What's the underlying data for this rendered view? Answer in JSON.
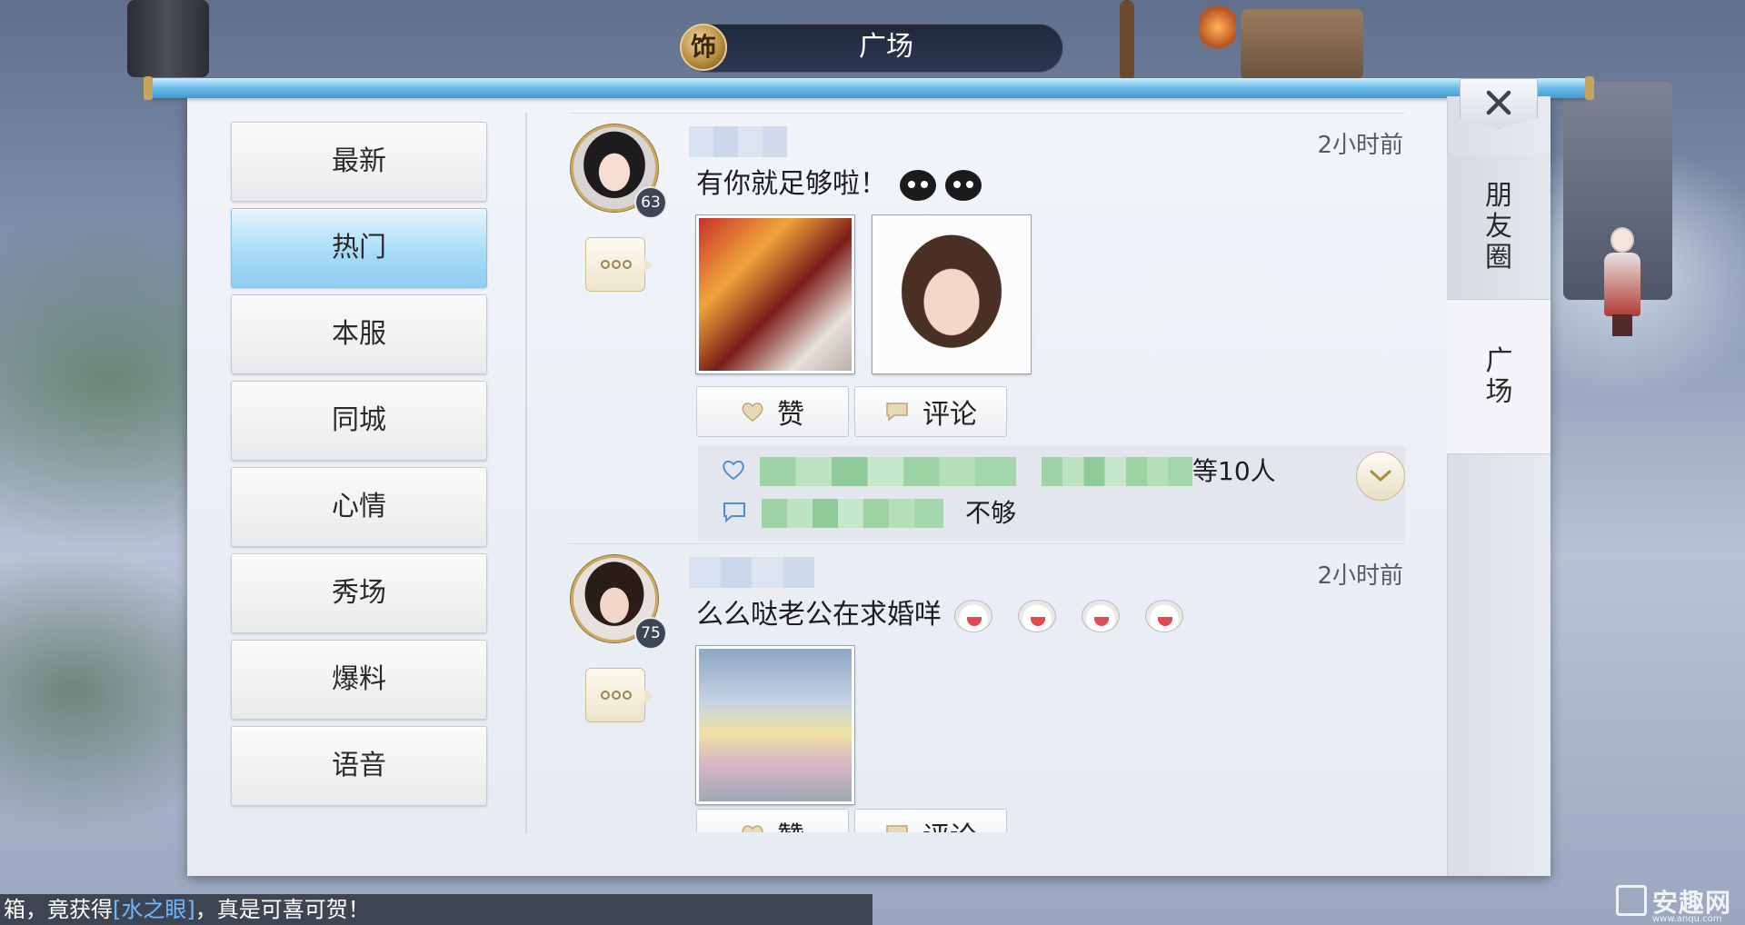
{
  "title_bar": {
    "emblem_char": "饰",
    "title": "广场"
  },
  "categories": [
    {
      "label": "最新",
      "active": false
    },
    {
      "label": "热门",
      "active": true
    },
    {
      "label": "本服",
      "active": false
    },
    {
      "label": "同城",
      "active": false
    },
    {
      "label": "心情",
      "active": false
    },
    {
      "label": "秀场",
      "active": false
    },
    {
      "label": "爆料",
      "active": false
    },
    {
      "label": "语音",
      "active": false
    }
  ],
  "side_tabs": {
    "friends": [
      "朋",
      "友",
      "圈"
    ],
    "square": [
      "广",
      "场"
    ]
  },
  "posts": [
    {
      "level": "63",
      "time": "2小时前",
      "text": "有你就足够啦！",
      "like_label": "赞",
      "comment_label": "评论",
      "likes_summary": "等10人",
      "comment_preview": "不够"
    },
    {
      "level": "75",
      "time": "2小时前",
      "text": "么么哒老公在求婚咩",
      "like_label": "赞",
      "comment_label": "评论"
    }
  ],
  "ticker": {
    "prefix": "箱，竟获得",
    "highlight": "[水之眼]",
    "suffix": "，真是可喜可贺！"
  },
  "watermark": {
    "name": "安趣网",
    "url": "www.anqu.com"
  },
  "colors": {
    "active_tab": "#a8dcf8",
    "header_strip": "#6bbbe9",
    "ticker_highlight": "#6fb8ff"
  }
}
